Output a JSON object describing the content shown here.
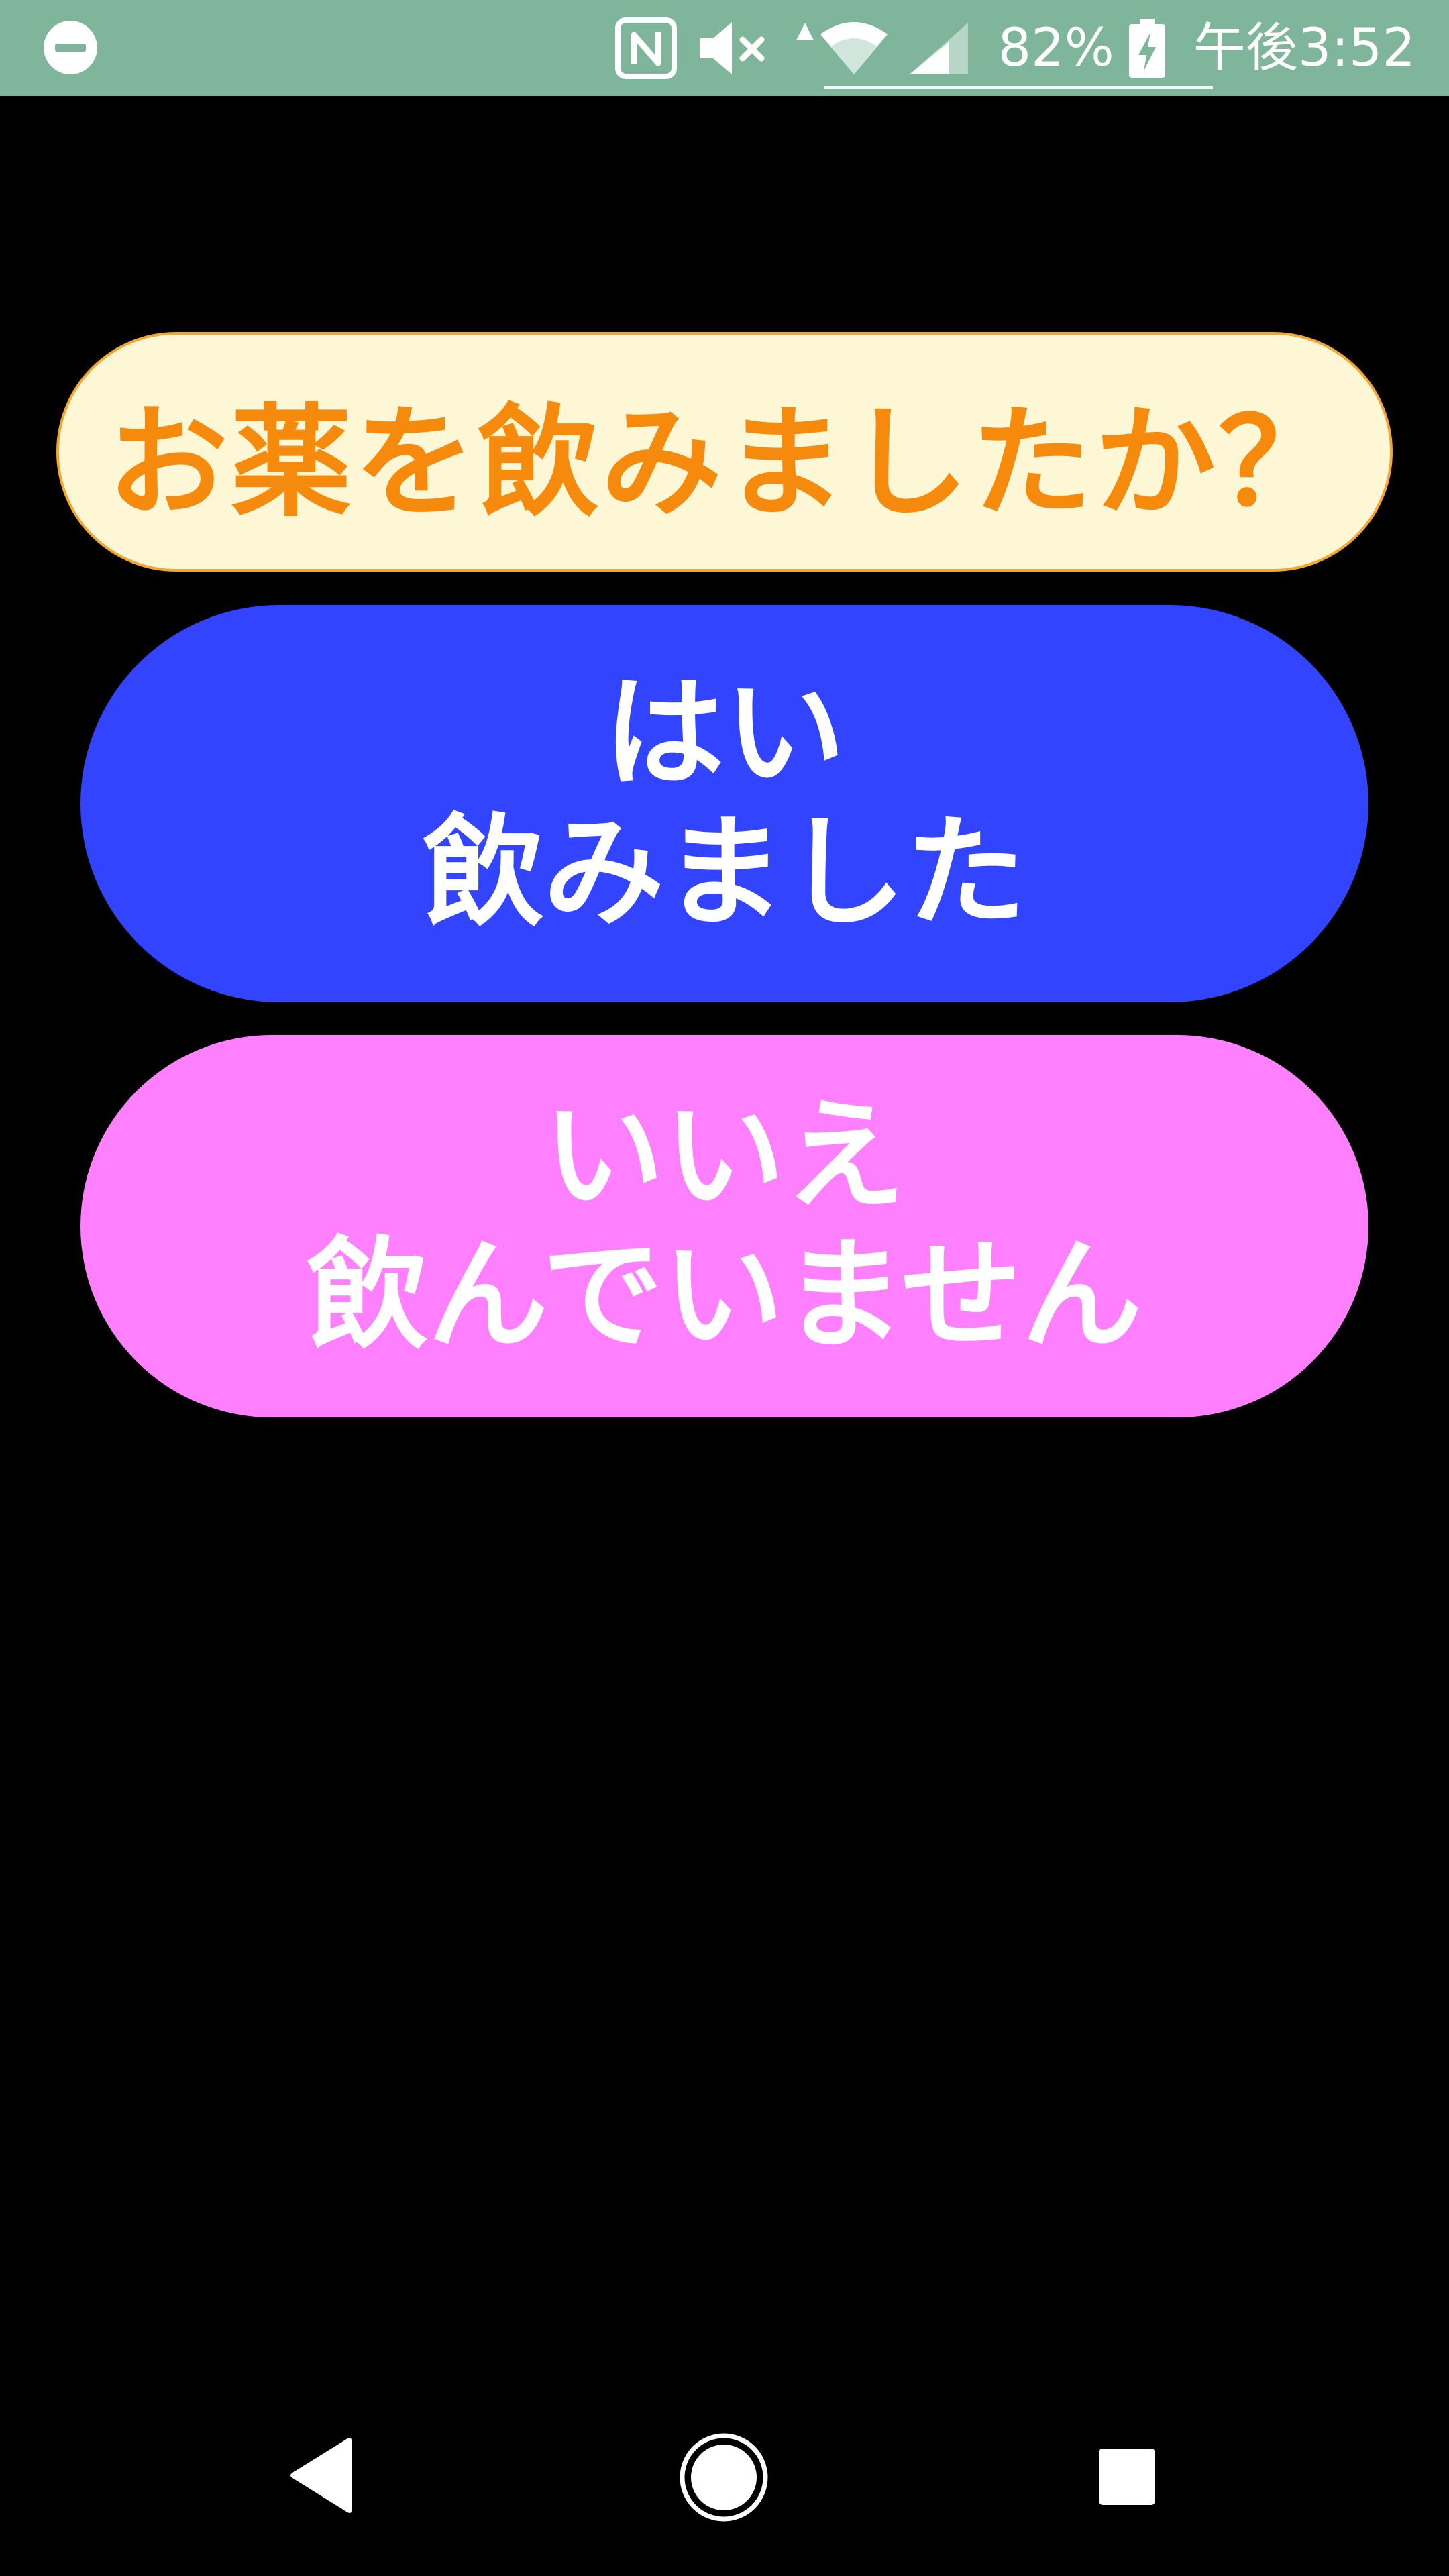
{
  "status_bar": {
    "battery_percent": "82%",
    "time": "午後3:52",
    "icons": [
      "dnd-icon",
      "nfc-icon",
      "mute-icon",
      "wifi-icon",
      "signal-icon",
      "battery-charging-icon"
    ],
    "background_color": "#7fb59b"
  },
  "prompt": {
    "question": "お薬を飲みましたか？",
    "text_color": "#f58a0c",
    "background_color": "#fdf7d6"
  },
  "answers": {
    "yes": {
      "line1": "はい",
      "line2": "飲みました",
      "color": "#3344ff"
    },
    "no": {
      "line1": "いいえ",
      "line2": "飲んでいません",
      "color": "#ff80ff"
    }
  },
  "nav_bar": {
    "icons": [
      "back-icon",
      "home-icon",
      "recents-icon"
    ]
  }
}
